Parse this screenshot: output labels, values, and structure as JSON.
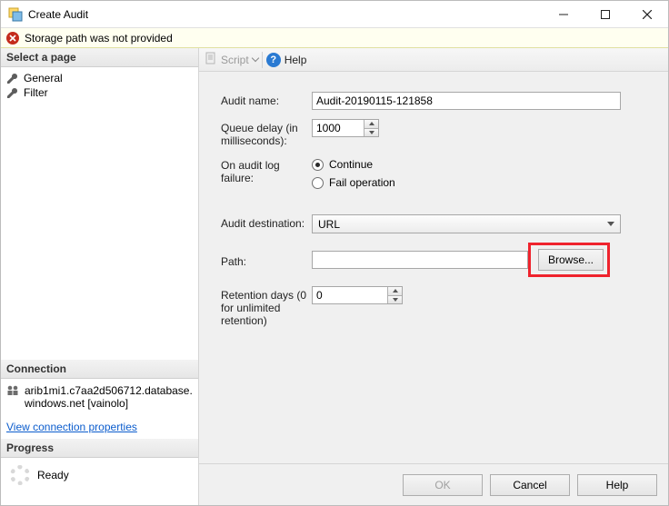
{
  "window": {
    "title": "Create Audit"
  },
  "error": {
    "message": "Storage path was not provided"
  },
  "sidebar": {
    "select_page_header": "Select a page",
    "items": [
      {
        "label": "General"
      },
      {
        "label": "Filter"
      }
    ],
    "connection_header": "Connection",
    "connection_value": "arib1mi1.c7aa2d506712.database.windows.net [vainolo]",
    "view_properties_link": "View connection properties",
    "progress_header": "Progress",
    "progress_status": "Ready"
  },
  "toolbar": {
    "script_label": "Script",
    "help_label": "Help"
  },
  "form": {
    "audit_name_label": "Audit name:",
    "audit_name_value": "Audit-20190115-121858",
    "queue_delay_label": "Queue delay (in milliseconds):",
    "queue_delay_value": "1000",
    "on_failure_label": "On audit log failure:",
    "on_failure_options": {
      "continue": "Continue",
      "fail": "Fail operation"
    },
    "audit_dest_label": "Audit destination:",
    "audit_dest_value": "URL",
    "path_label": "Path:",
    "path_value": "",
    "browse_label": "Browse...",
    "retention_label": "Retention days (0 for unlimited retention)",
    "retention_value": "0"
  },
  "buttons": {
    "ok": "OK",
    "cancel": "Cancel",
    "help": "Help"
  }
}
